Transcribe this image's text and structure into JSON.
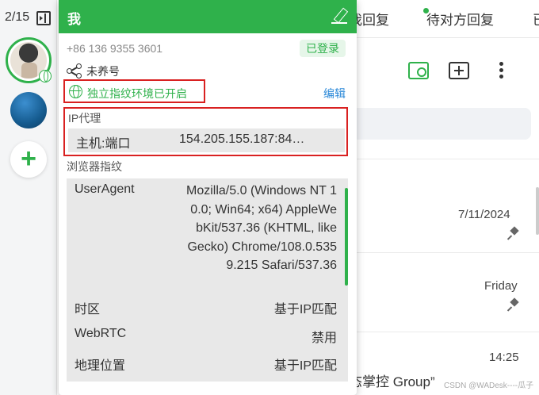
{
  "rail": {
    "counter": "2/15",
    "avatars": [
      "profile-avatar",
      "account-avatar-2"
    ],
    "add_label": "+"
  },
  "background": {
    "tabs": [
      "我回复",
      "待对方回复",
      "已"
    ],
    "chats": [
      {
        "date": "7/11/2024",
        "pinned": true
      },
      {
        "date": "Friday",
        "pinned": true
      },
      {
        "date": "14:25",
        "pinned": false
      }
    ],
    "preview_text": "态掌控 Group”",
    "watermark": "CSDN @WADesk----瓜子"
  },
  "popup": {
    "title": "我",
    "phone": "+86 136 9355 3601",
    "login_badge": "已登录",
    "nurture_label": "未养号",
    "fingerprint_env": "独立指纹环境已开启",
    "edit_link": "编辑",
    "ip_section": {
      "title": "IP代理",
      "host_label": "主机:端口",
      "host_value": "154.205.155.187:84…"
    },
    "fp_section": {
      "title": "浏览器指纹",
      "useragent_label": "UserAgent",
      "useragent_value": "Mozilla/5.0 (Windows NT 10.0; Win64; x64) AppleWebKit/537.36 (KHTML, like Gecko) Chrome/108.0.5359.215 Safari/537.36",
      "timezone_label": "时区",
      "timezone_value": "基于IP匹配",
      "webrtc_label": "WebRTC",
      "webrtc_value": "禁用",
      "geo_label": "地理位置",
      "geo_value": "基于IP匹配"
    }
  },
  "colors": {
    "accent": "#2fb14b",
    "highlight_border": "#d92121",
    "link": "#2a88d8"
  }
}
